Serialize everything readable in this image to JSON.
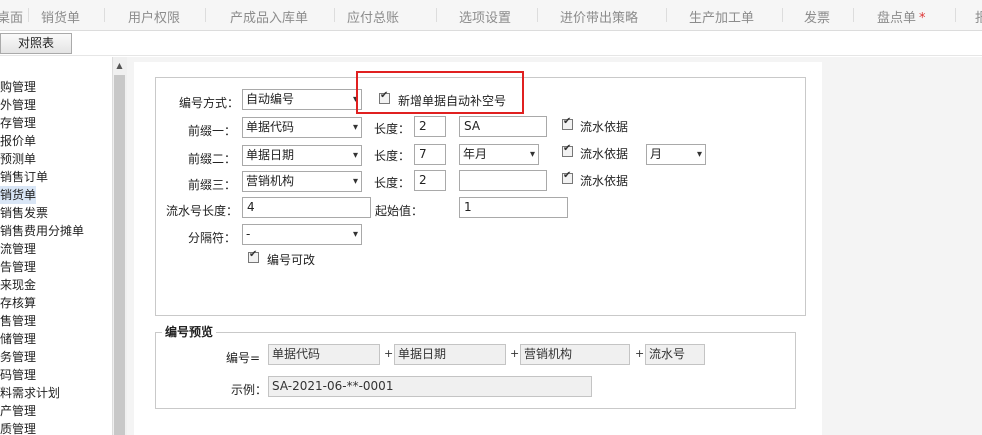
{
  "top_tabs": [
    "桌面",
    "销货单",
    "用户权限",
    "产成品入库单",
    "应付总账",
    "选项设置",
    "进价带出策略",
    "生产加工单",
    "发票",
    "盘点单",
    "报"
  ],
  "compare_button": "对照表",
  "nav_items": [
    "购管理",
    "外管理",
    "存管理",
    "报价单",
    "预测单",
    "销售订单",
    "销货单",
    "销售发票",
    "销售费用分摊单",
    "流管理",
    "告管理",
    "来现金",
    "存核算",
    "售管理",
    "储管理",
    "务管理",
    "码管理",
    "料需求计划",
    "产管理",
    "质管理"
  ],
  "form": {
    "numbering_label": "编号方式：",
    "numbering_value": "自动编号",
    "fill_gap_label": "新增单据自动补空号",
    "prefix1_label": "前缀一：",
    "prefix1_value": "单据代码",
    "prefix2_label": "前缀二：",
    "prefix2_value": "单据日期",
    "prefix3_label": "前缀三：",
    "prefix3_value": "营销机构",
    "length_label": "长度：",
    "len1": "2",
    "len2": "7",
    "len3": "2",
    "extra1": "SA",
    "extra2_select": "年月",
    "extra3": "",
    "serial_basis_label": "流水依据",
    "serial_basis2_select": "月",
    "serial_len_label": "流水号长度：",
    "serial_len": "4",
    "start_label": "起始值：",
    "start_value": "1",
    "separator_label": "分隔符：",
    "separator_value": "-",
    "editable_label": "编号可改"
  },
  "preview": {
    "legend": "编号预览",
    "code_label": "编号=",
    "parts": [
      "单据代码",
      "单据日期",
      "营销机构",
      "流水号"
    ],
    "plus": "+",
    "example_label": "示例：",
    "example_value": "SA-2021-06-**-0001"
  },
  "colors": {
    "highlight_border": "#e02020",
    "active_nav": "#d9e6f6",
    "unsaved_star": "#d33333"
  }
}
